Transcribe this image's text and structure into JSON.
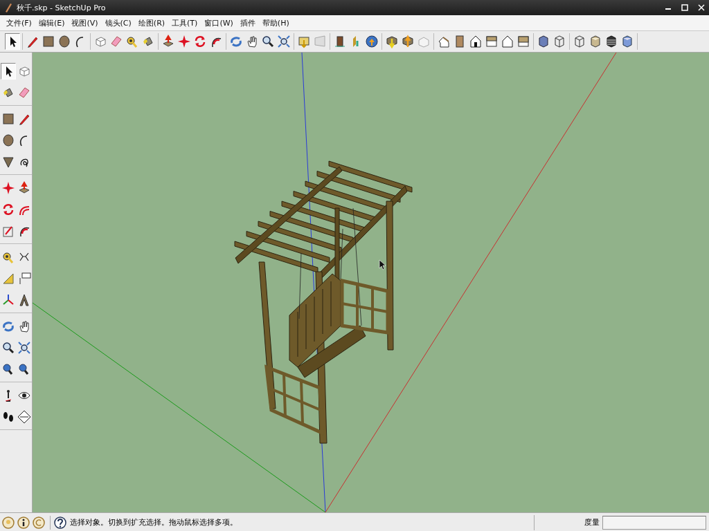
{
  "window": {
    "title": "秋千.skp - SketchUp Pro"
  },
  "menu": [
    {
      "label": "文件(F)"
    },
    {
      "label": "编辑(E)"
    },
    {
      "label": "视图(V)"
    },
    {
      "label": "镜头(C)"
    },
    {
      "label": "绘图(R)"
    },
    {
      "label": "工具(T)"
    },
    {
      "label": "窗口(W)"
    },
    {
      "label": "插件"
    },
    {
      "label": "帮助(H)"
    }
  ],
  "toolbar": {
    "select_tool_selected": true
  },
  "tool_palette": {
    "select_tool_selected": true
  },
  "status_bar": {
    "hint": "选择对象。切换到扩充选择。拖动鼠标选择多项。",
    "measurement_label": "度量"
  }
}
